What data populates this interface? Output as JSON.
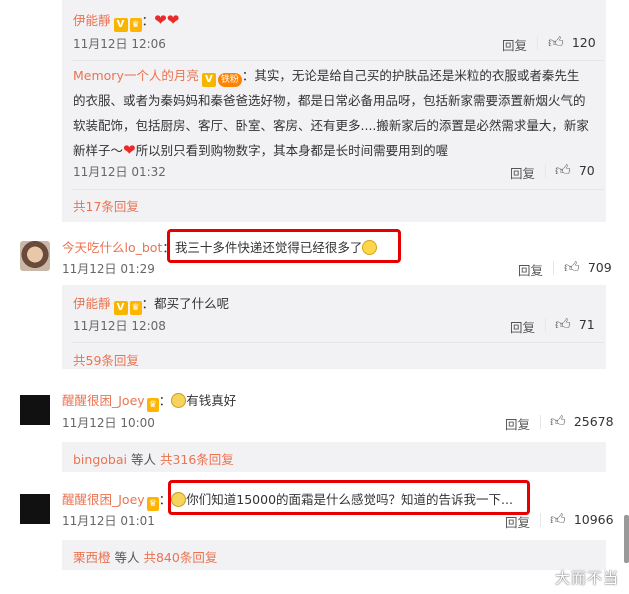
{
  "comments": [
    {
      "author": "伊能靜",
      "text": "：",
      "time": "11月12日 12:06",
      "reply": "回复",
      "likes": "120",
      "badges": [
        "v-badge",
        "level-badge"
      ],
      "emoji": [
        "heart-icon",
        "heart-icon"
      ]
    },
    {
      "author": "Memory一个人的月亮",
      "text_lines": [
        "：其实，无论是给自己买的护肤品还是米粒的衣服或者秦先生",
        "的衣服、或者为秦妈妈和秦爸爸选好物，都是日常必备用品呀，包括新家需要添置新烟火气的",
        "软装配饰，包括厨房、客厅、卧室、客房、还有更多....搬新家后的添置是必然需求量大，新家",
        "新样子～",
        "所以别只看到购物数字，其本身都是长时间需要用到的喔"
      ],
      "time": "11月12日 01:32",
      "reply": "回复",
      "likes": "70",
      "fan_badge": "铁粉"
    },
    {
      "more": "共17条回复"
    },
    {
      "author": "今天吃什么lo_bot",
      "text": "：我三十多件快递还觉得已经很多了",
      "time": "11月12日 01:29",
      "reply": "回复",
      "likes": "709"
    },
    {
      "author": "伊能靜",
      "text": "：都买了什么呢",
      "time": "11月12日 12:08",
      "reply": "回复",
      "likes": "71"
    },
    {
      "more": "共59条回复"
    },
    {
      "author": "醒醒很困_Joey",
      "text": "：",
      "text2": "有钱真好",
      "time": "11月12日 10:00",
      "reply": "回复",
      "likes": "25678"
    },
    {
      "more_author": "bingobai",
      "more_mid": " 等人 ",
      "more": "共316条回复"
    },
    {
      "author": "醒醒很困_Joey",
      "text": "：",
      "text2": "你们知道15000的面霜是什么感觉吗？知道的告诉我一下...",
      "time": "11月12日 01:01",
      "reply": "回复",
      "likes": "10966"
    },
    {
      "more_author": "栗西橙",
      "more_mid": " 等人 ",
      "more": "共840条回复"
    }
  ],
  "watermark": "大而不当",
  "colors": {
    "name": "#eb7350",
    "highlight": "#e60000",
    "panel": "#f2f2f5"
  }
}
